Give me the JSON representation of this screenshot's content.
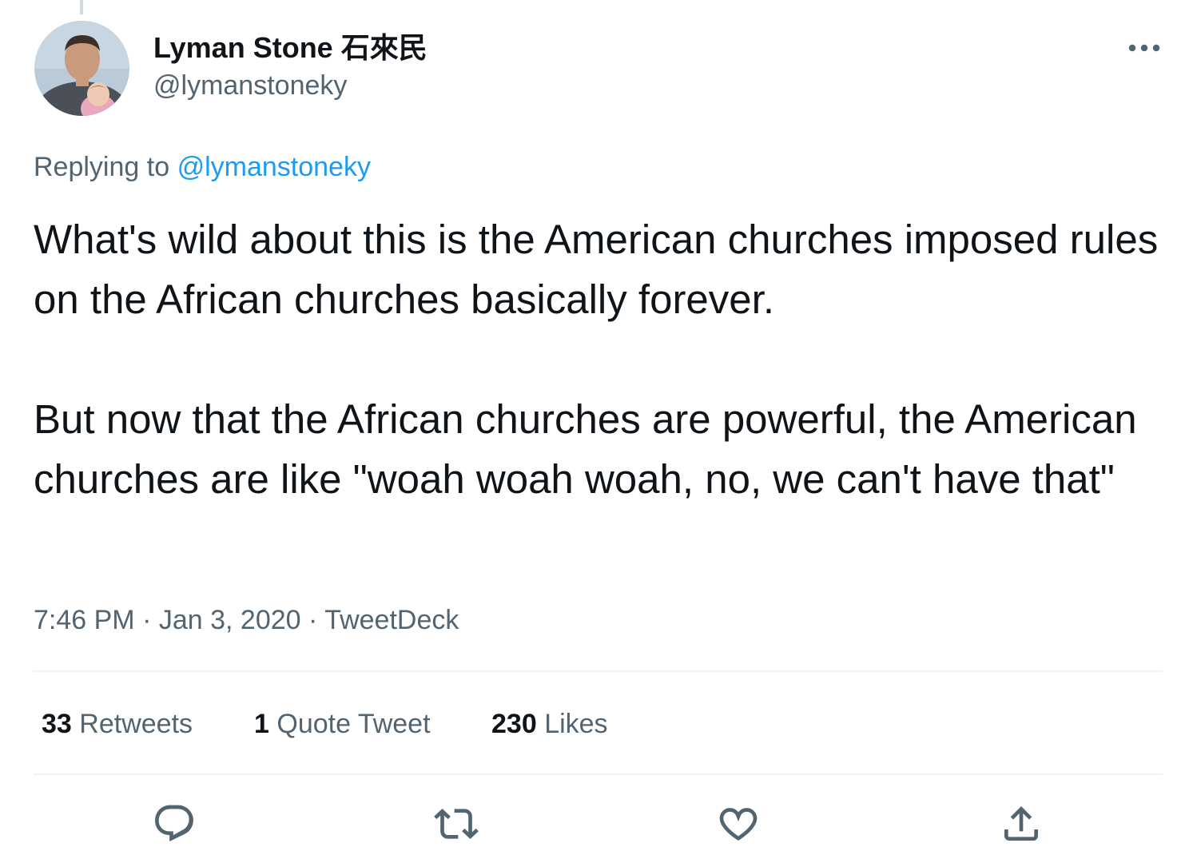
{
  "author": {
    "display_name": "Lyman Stone 石來民",
    "handle": "@lymanstoneky",
    "avatar": "profile-photo"
  },
  "reply_context": {
    "prefix": "Replying to",
    "mention": "@lymanstoneky"
  },
  "tweet": {
    "paragraphs": [
      "What's wild about this is the American churches imposed rules on the African churches basically forever.",
      "But now that the African churches are powerful, the American churches are like \"woah woah woah, no, we can't have that\""
    ]
  },
  "meta": {
    "time": "7:46 PM",
    "separator": "·",
    "date": "Jan 3, 2020",
    "source": "TweetDeck"
  },
  "stats": {
    "retweets": {
      "count": "33",
      "label": "Retweets"
    },
    "quotes": {
      "count": "1",
      "label": "Quote Tweet"
    },
    "likes": {
      "count": "230",
      "label": "Likes"
    }
  },
  "icons": {
    "more": "more-horizontal-icon",
    "reply": "reply-icon",
    "retweet": "retweet-icon",
    "like": "heart-icon",
    "share": "share-icon"
  },
  "colors": {
    "text_primary": "#0f1419",
    "text_secondary": "#536471",
    "accent": "#1d9bf0",
    "divider": "#eff3f4"
  }
}
